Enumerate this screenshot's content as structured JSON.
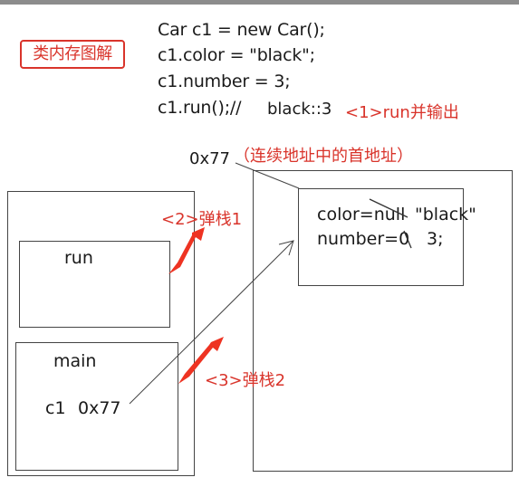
{
  "title": "类内存图解",
  "code_lines": [
    "Car c1 = new Car();",
    "c1.color = \"black\";",
    "c1.number = 3;",
    "c1.run();//"
  ],
  "run_output": {
    "value": "black::3",
    "note": "<1>run并输出"
  },
  "address": {
    "value": "0x77",
    "note": "（连续地址中的首地址）"
  },
  "stack": {
    "run_frame": {
      "label": "run"
    },
    "main_frame": {
      "label": "main",
      "var_name": "c1",
      "var_value": "0x77"
    }
  },
  "heap": {
    "object": {
      "color_field": "color=null",
      "color_new": "\"black\"",
      "number_field": "number=0",
      "number_new": "3;"
    }
  },
  "push_labels": {
    "first": "<2>弹栈1",
    "second": "<3>弹栈2"
  },
  "colors": {
    "annotation": "#d9342b",
    "line": "#444444",
    "arrow": "#ee3322"
  }
}
